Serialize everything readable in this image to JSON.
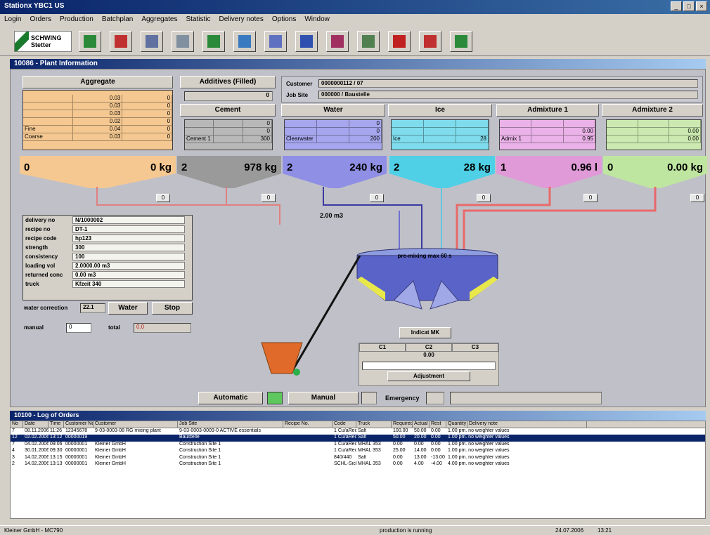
{
  "window": {
    "title": "Stationx YBC1 US"
  },
  "menu": [
    "Login",
    "Orders",
    "Production",
    "Batchplan",
    "Aggregates",
    "Statistic",
    "Delivery notes",
    "Options",
    "Window"
  ],
  "toolbar": {
    "logo_line1": "SCHWING",
    "logo_line2": "Stetter",
    "icons": [
      "recipes-icon",
      "materials-icon",
      "silos-icon",
      "cancel-icon",
      "customers-icon",
      "trucks-icon",
      "plant-overview-icon",
      "reports-icon",
      "monitor-icon",
      "statistics-icon",
      "factory-icon",
      "ex-icon",
      "exit-icon"
    ]
  },
  "mdi": {
    "title": "10086 - Plant Information"
  },
  "dispatch": {
    "customer_label": "Customer",
    "customer_value": "0000000112 / 07",
    "jobsite_label": "Job Site",
    "jobsite_value": "000000 / Baustelle"
  },
  "bins": [
    {
      "name": "Aggregate",
      "color": "#f5c891",
      "rows": [
        [
          "",
          "0.03",
          "0"
        ],
        [
          "",
          "0.03",
          "0"
        ],
        [
          "",
          "0.03",
          "0"
        ],
        [
          "",
          "0.02",
          "0"
        ],
        [
          "Fine",
          "0.04",
          "0"
        ],
        [
          "Coarse",
          "0.03",
          "0"
        ]
      ],
      "hopper_left": "0",
      "hopper_right": "0 kg",
      "indicator": "0"
    },
    {
      "name": "Cement",
      "color": "#b8b8b8",
      "rows": [
        [
          "",
          "",
          "0"
        ],
        [
          "",
          "",
          "0"
        ],
        [
          "",
          "",
          "0"
        ],
        [
          "",
          "",
          "0"
        ],
        [
          "",
          "",
          "0"
        ],
        [
          "Cement 1",
          "",
          "300"
        ]
      ],
      "hopper_left": "2",
      "hopper_right": "978 kg",
      "indicator": "0"
    },
    {
      "name": "Water",
      "color": "#a6a6ee",
      "rows": [
        [
          "",
          "",
          ""
        ],
        [
          "",
          "",
          ""
        ],
        [
          "",
          "",
          ""
        ],
        [
          "",
          "",
          "0"
        ],
        [
          "",
          "",
          "0"
        ],
        [
          "Clearwater",
          "",
          "200"
        ]
      ],
      "hopper_left": "2",
      "hopper_right": "240 kg",
      "indicator": "0"
    },
    {
      "name": "Ice",
      "color": "#7fdcec",
      "rows": [
        [
          "",
          "",
          ""
        ],
        [
          "",
          "",
          ""
        ],
        [
          "",
          "",
          ""
        ],
        [
          "",
          "",
          ""
        ],
        [
          "",
          "",
          ""
        ],
        [
          "Ice",
          "",
          "28"
        ]
      ],
      "hopper_left": "2",
      "hopper_right": "28 kg",
      "indicator": "0"
    },
    {
      "name": "Admixture 1",
      "color": "#eab2e8",
      "rows": [
        [
          "",
          "",
          ""
        ],
        [
          "",
          "",
          "0.00"
        ],
        [
          "",
          "",
          "0.00"
        ],
        [
          "",
          "",
          ""
        ],
        [
          "",
          "",
          "0.00"
        ],
        [
          "Admix 1",
          "",
          "0.95"
        ]
      ],
      "hopper_left": "1",
      "hopper_right": "0.96 l",
      "indicator": "0"
    },
    {
      "name": "Admixture 2",
      "color": "#cbe9b0",
      "rows": [
        [
          "",
          "",
          ""
        ],
        [
          "",
          "",
          "0.00"
        ],
        [
          "",
          "",
          "0.00"
        ],
        [
          "",
          "",
          ""
        ],
        [
          "",
          "",
          "0.00"
        ],
        [
          "",
          "",
          "0.00"
        ]
      ],
      "hopper_left": "0",
      "hopper_right": "0.00 kg",
      "indicator": "0"
    }
  ],
  "additive": {
    "label": "Additives (Filled)",
    "value": "0"
  },
  "volume_label": "2.00 m3",
  "info": [
    {
      "k": "delivery no",
      "v": "N/1000002"
    },
    {
      "k": "recipe no",
      "v": "DT-1"
    },
    {
      "k": "recipe code",
      "v": "hp123"
    },
    {
      "k": "strength",
      "v": "300"
    },
    {
      "k": "consistency",
      "v": "100"
    },
    {
      "k": "loading vol",
      "v": "2.0000.00 m3"
    },
    {
      "k": "returned conc",
      "v": "0.00 m3"
    },
    {
      "k": "truck",
      "v": "Kfzeit 340"
    }
  ],
  "controls": {
    "water_correction_label": "water correction",
    "water_correction_value": "22.1",
    "water_btn": "Water",
    "stop_btn": "Stop",
    "manual_label": "manual",
    "manual_value": "0",
    "total_label": "total",
    "total_value": "0.0"
  },
  "mixer": {
    "label": "pre-mixing max 60 s",
    "indicator_label": "Indicat MK",
    "c1": "C1",
    "c2": "C2",
    "c3": "C3",
    "value": "0.00",
    "adjust": "Adjustment"
  },
  "bottom": {
    "automatic": "Automatic",
    "manual": "Manual",
    "emergency": "Emergency"
  },
  "log": {
    "title": "10100 - Log of Orders",
    "headers": [
      "No",
      "Date",
      "Time",
      "Customer No.",
      "Customer",
      "Job Site",
      "Recipe No.",
      "Code",
      "Truck",
      "Required",
      "Actual",
      "Rest",
      "Quantity",
      "Delivery note"
    ],
    "rows": [
      [
        "7",
        "08.11.2006",
        "11:26",
        "12345678",
        "9-03-0003-08  RG mixing plant",
        "9-03-0003-0009-0 ACTIVE essentials",
        "1 Cu/aRecl",
        "Salt",
        "100.00",
        "50.00",
        "0.00",
        "1.00 pm. no weighter values"
      ],
      [
        "12",
        "02.02.2006",
        "13:12",
        "00000019",
        "",
        "Baustelle",
        "1 Cu/aRecl",
        "Salt",
        "50.00",
        "20.00",
        "0.00",
        "1.00 pm. no weighter values"
      ],
      [
        "7",
        "04.02.2006",
        "09:06",
        "00000001",
        "Kleiner GmbH",
        "Construction Site 1",
        "1 Cu/aRecl",
        "MHAL 353",
        "0.00",
        "0.00",
        "0.00",
        "1.00 pm. no weighter values"
      ],
      [
        "4",
        "30.01.2006",
        "09:30",
        "00000001",
        "Kleiner GmbH",
        "Construction Site 1",
        "1 Cu/aRecl",
        "MHAL 353",
        "25.00",
        "14.00",
        "0.00",
        "1.00 pm. no weighter values"
      ],
      [
        "3",
        "14.02.2006",
        "13:15",
        "00000001",
        "Kleiner GmbH",
        "Construction Site 1",
        "840/440",
        "Salt",
        "0.00",
        "13.00",
        "-13.00",
        "1.00 pm. no weighter values"
      ],
      [
        "2",
        "14.02.2006",
        "13:13",
        "00000001",
        "Kleiner GmbH",
        "Construction Site 1",
        "SCHL-Sichtage",
        "MHAL 353",
        "0.00",
        "4.00",
        "-4.00",
        "4.00 pm. no weighter values"
      ]
    ]
  },
  "status": {
    "left": "Kleiner GmbH - MC790",
    "middle": "production is running",
    "date": "24.07.2006",
    "time": "13:21"
  }
}
